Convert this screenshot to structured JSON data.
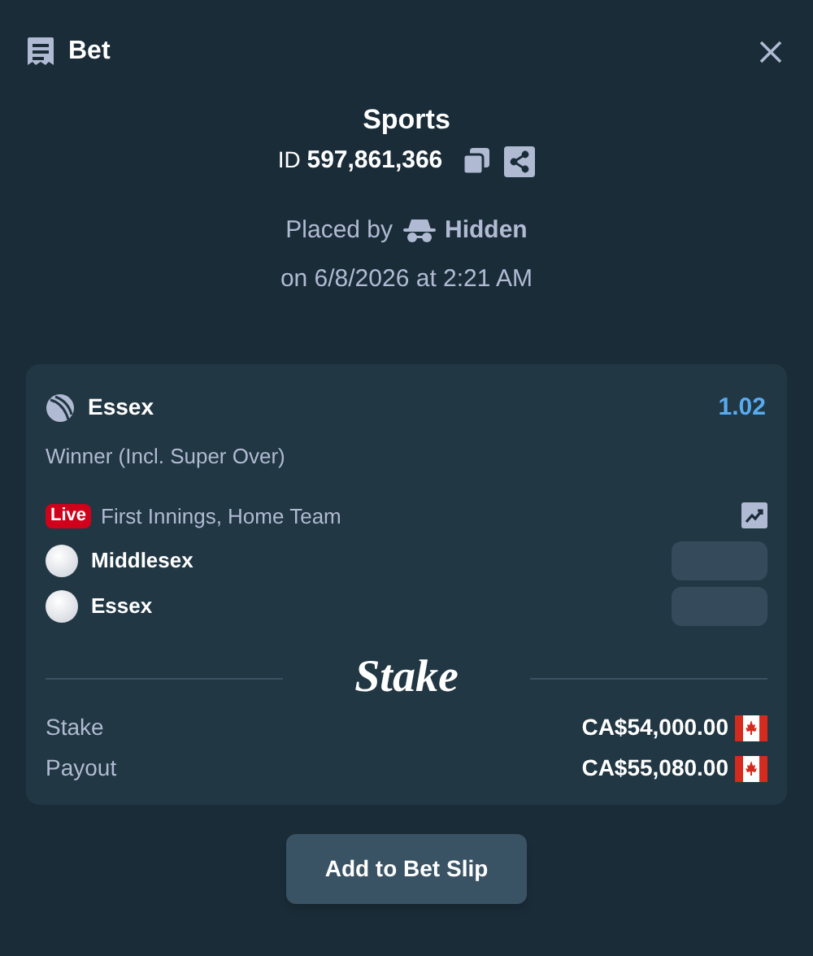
{
  "header": {
    "title": "Bet"
  },
  "summary": {
    "category": "Sports",
    "id_label": "ID",
    "id_value": "597,861,366",
    "placed_by_label": "Placed by",
    "placed_by_user": "Hidden",
    "placed_on": "on 6/8/2026 at 2:21 AM"
  },
  "selection": {
    "outcome": "Essex",
    "odds": "1.02",
    "market": "Winner (Incl. Super Over)"
  },
  "event": {
    "live": true,
    "live_label": "Live",
    "name": "First Innings, Home Team",
    "teams": [
      {
        "name": "Middlesex"
      },
      {
        "name": "Essex"
      }
    ]
  },
  "brand": "Stake",
  "amounts": [
    {
      "label": "Stake",
      "value": "CA$54,000.00"
    },
    {
      "label": "Payout",
      "value": "CA$55,080.00"
    }
  ],
  "button": "Add to Bet Slip"
}
